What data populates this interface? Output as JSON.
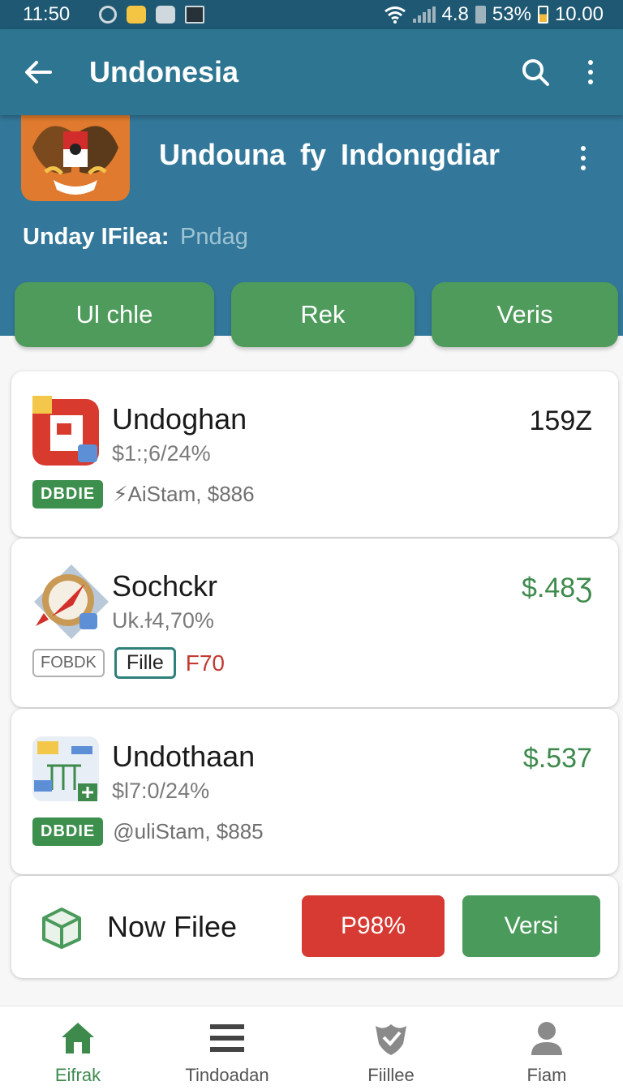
{
  "status_bar": {
    "time": "11:50",
    "network": "4.8",
    "battery": "53%",
    "battery2": "10.00"
  },
  "app_bar": {
    "title": "Undonesia"
  },
  "header": {
    "name": "Undouna fy Indonıgdiar",
    "label": "Unday IFilea:",
    "value": "Pndag"
  },
  "actions": [
    {
      "label": "Ul chle"
    },
    {
      "label": "Rek"
    },
    {
      "label": "Veris"
    }
  ],
  "items": [
    {
      "name": "Undoghan",
      "sub": "$1:;6/24%",
      "price": "159Z",
      "badge": "DBDIE",
      "meta": "⚡AiStam, $886"
    },
    {
      "name": "Sochckr",
      "sub": "Uk.ɫ4,70%",
      "price": "$.48Ʒ",
      "badge": "FOBDK",
      "tag": "Fille",
      "extra": "F70"
    },
    {
      "name": "Undothaan",
      "sub": "$l7:0/24%",
      "price": "$.537",
      "badge": "DBDIE",
      "meta": "@uliStam, $885"
    }
  ],
  "new_file": {
    "label": "Now Filee",
    "primary": "P98%",
    "secondary": "Versi"
  },
  "bottom_nav": [
    {
      "label": "Eifrak",
      "active": true
    },
    {
      "label": "Tindoadan"
    },
    {
      "label": "Fiillee"
    },
    {
      "label": "Fiam"
    }
  ],
  "colors": {
    "primary": "#2d7590",
    "header": "#33789a",
    "green": "#4f9b5c",
    "red": "#d63a33",
    "price_green": "#3e8a4d"
  }
}
